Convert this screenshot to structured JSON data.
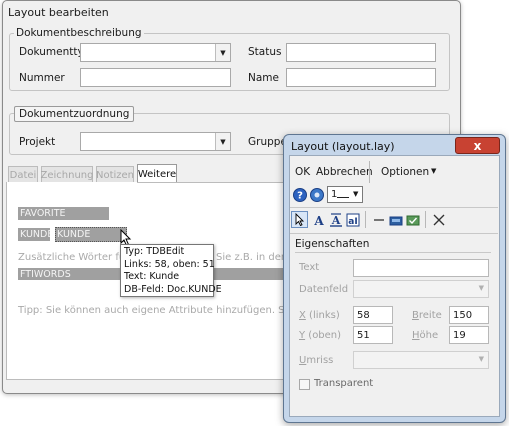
{
  "main_window": {
    "title": "Layout bearbeiten",
    "group_description": {
      "legend": "Dokumentbeschreibung",
      "doctype_label": "Dokumenttyp",
      "doctype_value": "",
      "status_label": "Status",
      "status_value": "",
      "number_label": "Nummer",
      "number_value": "",
      "name_label": "Name",
      "name_value": ""
    },
    "group_assignment": {
      "legend": "Dokumentzuordnung",
      "project_label": "Projekt",
      "project_value": "",
      "group_label": "Gruppe"
    },
    "tabs": [
      {
        "label": "Datei",
        "active": false
      },
      {
        "label": "Zeichnung",
        "active": false
      },
      {
        "label": "Notizen",
        "active": false
      },
      {
        "label": "Weitere",
        "active": true
      }
    ],
    "canvas": {
      "field_favorite": "FAVORITE",
      "label_kunde": "KUNDE",
      "field_kunde": "KUNDE",
      "hint_text_left": "Zusätzliche Wörter für die",
      "hint_text_right": "Sie z.B. in den N",
      "field_ftiwords": "FTIWORDS",
      "tip_text": "Tipp: Sie können auch eigene Attribute hinzufügen. Siehe Menü"
    },
    "tooltip": {
      "type_line": "Typ: TDBEdit",
      "pos_line": "Links: 58, oben: 51",
      "text_line": "Text: Kunde",
      "dbfield_line": "DB-Feld: Doc.KUNDE"
    }
  },
  "layout_window": {
    "title": "Layout (layout.lay)",
    "close_glyph": "x",
    "toolbar": {
      "ok_label": "OK",
      "cancel_label": "Abbrechen",
      "options_label": "Optionen",
      "grid_value": "1"
    },
    "properties": {
      "heading": "Eigenschaften",
      "text_label": "Text",
      "text_value": "",
      "datafield_label": "Datenfeld",
      "datafield_value": "",
      "x_label_key": "X",
      "x_label_rest": " (links)",
      "x_value": "58",
      "width_label_key": "B",
      "width_label_rest": "reite",
      "width_value": "150",
      "y_label_key": "Y",
      "y_label_rest": " (oben)",
      "y_value": "51",
      "height_label_key": "H",
      "height_label_rest": "öhe",
      "height_value": "19",
      "border_label_key": "U",
      "border_label_rest": "mriss",
      "border_value": "",
      "transparent_label": "Transparent",
      "transparent_checked": false
    }
  },
  "colors": {
    "field_gray": "#a0a0a0",
    "palette_frame": "#c5d6ea",
    "close_red": "#c84232"
  }
}
